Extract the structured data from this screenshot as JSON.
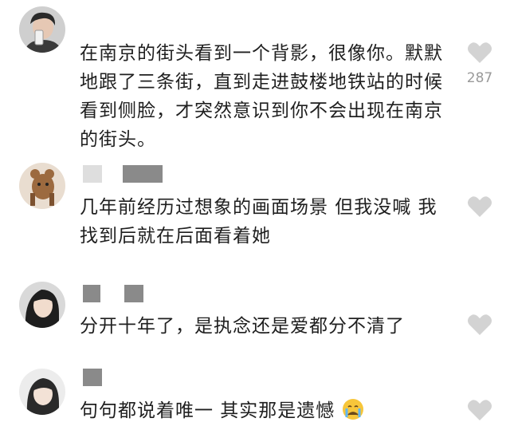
{
  "comments": [
    {
      "text": "在南京的街头看到一个背影，很像你。默默地跟了三条街，直到走进鼓楼地铁站的时候看到侧脸，才突然意识到你不会出现在南京的街头。",
      "likes": "287"
    },
    {
      "text": "几年前经历过想象的画面场景 但我没喊 我找到后就在后面看着她",
      "likes": ""
    },
    {
      "text": "分开十年了，是执念还是爱都分不清了",
      "likes": ""
    },
    {
      "text": "句句都说着唯一 其实那是遗憾",
      "emoji": "crying-face",
      "likes": ""
    }
  ],
  "colors": {
    "like_icon": "#d3d3d3",
    "name_block_light": "#dedede",
    "name_block_dark": "#8a8a8a"
  }
}
